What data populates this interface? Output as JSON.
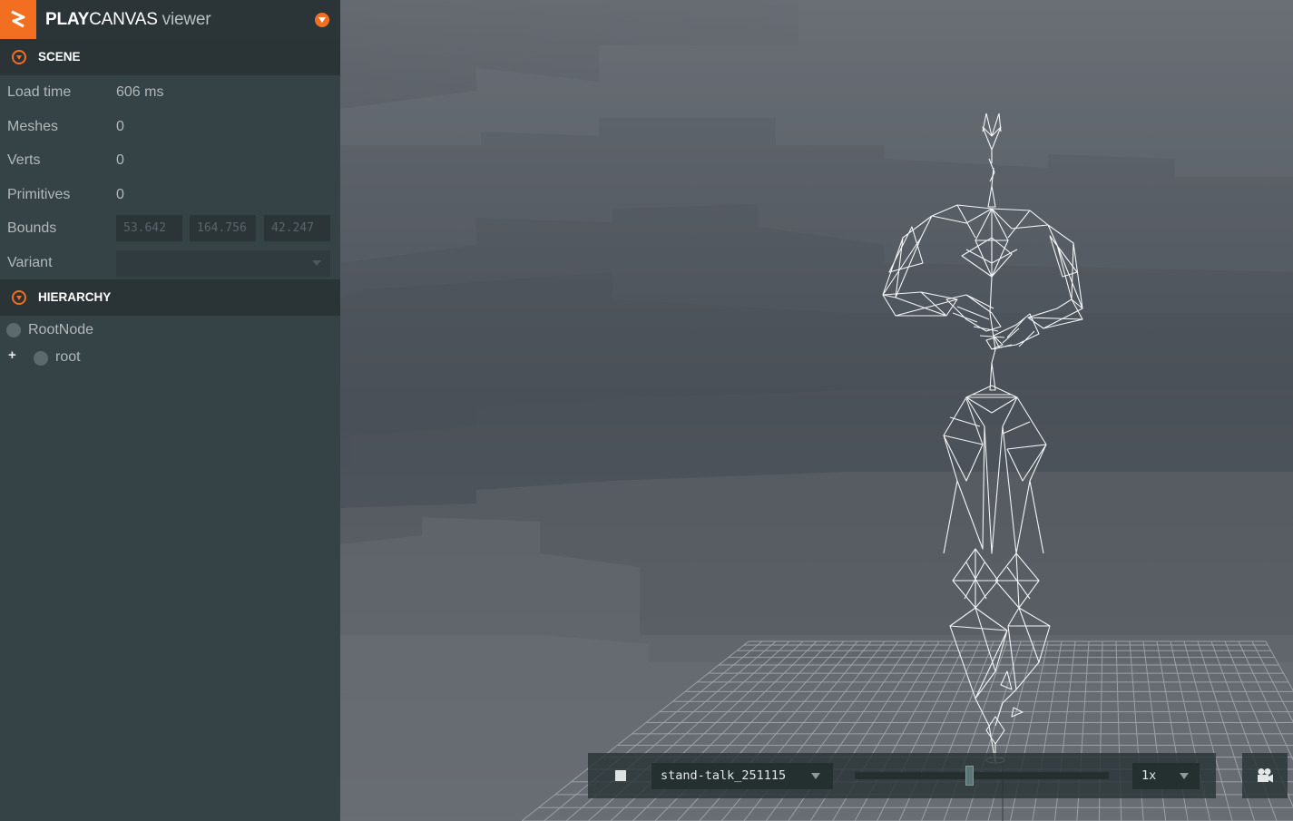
{
  "app": {
    "brand_bold": "PLAY",
    "brand_rest": "CANVAS",
    "brand_suffix": "viewer"
  },
  "scene": {
    "heading": "SCENE",
    "rows": [
      {
        "label": "Load time",
        "value": "606 ms"
      },
      {
        "label": "Meshes",
        "value": "0"
      },
      {
        "label": "Verts",
        "value": "0"
      },
      {
        "label": "Primitives",
        "value": "0"
      }
    ],
    "bounds_label": "Bounds",
    "bounds": [
      "53.642",
      "164.756",
      "42.247"
    ],
    "variant_label": "Variant",
    "variant_value": ""
  },
  "hierarchy": {
    "heading": "HIERARCHY",
    "nodes": [
      {
        "name": "RootNode"
      },
      {
        "name": "root"
      }
    ],
    "expand_glyph": "+"
  },
  "animation": {
    "track": "stand-talk_251115",
    "progress": 0.45,
    "speed": "1x"
  },
  "colors": {
    "accent": "#f26f21",
    "panel": "#364346",
    "panel_header": "#2a3437"
  },
  "icons": {
    "logo": "playcanvas-logo-icon",
    "menu": "menu-dropdown-icon",
    "collapse": "collapse-circle-icon",
    "stop": "stop-icon",
    "camera": "camera-icon"
  }
}
